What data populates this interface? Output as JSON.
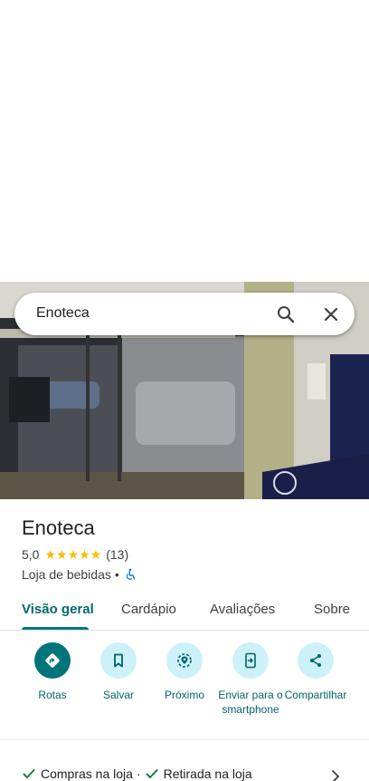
{
  "search": {
    "query": "Enoteca"
  },
  "place": {
    "name": "Enoteca",
    "rating": "5,0",
    "stars": "★★★★★",
    "review_count": "(13)",
    "category": "Loja de bebidas",
    "category_sep": "•"
  },
  "tabs": [
    {
      "label": "Visão geral",
      "active": true
    },
    {
      "label": "Cardápio"
    },
    {
      "label": "Avaliações"
    },
    {
      "label": "Sobre"
    }
  ],
  "actions": [
    {
      "label": "Rotas",
      "icon": "directions-icon"
    },
    {
      "label": "Salvar",
      "icon": "bookmark-icon"
    },
    {
      "label": "Próximo",
      "icon": "nearby-icon"
    },
    {
      "label": "Enviar para o smartphone",
      "icon": "send-to-phone-icon"
    },
    {
      "label": "Compartilhar",
      "icon": "share-icon"
    }
  ],
  "features": {
    "item1": "Compras na loja",
    "sep": "·",
    "item2": "Retirada na loja"
  },
  "colors": {
    "accent": "#00747a",
    "accent_text": "#00696f",
    "action_bg": "#cdf1f8",
    "star": "#fbbc04",
    "check": "#188038"
  }
}
